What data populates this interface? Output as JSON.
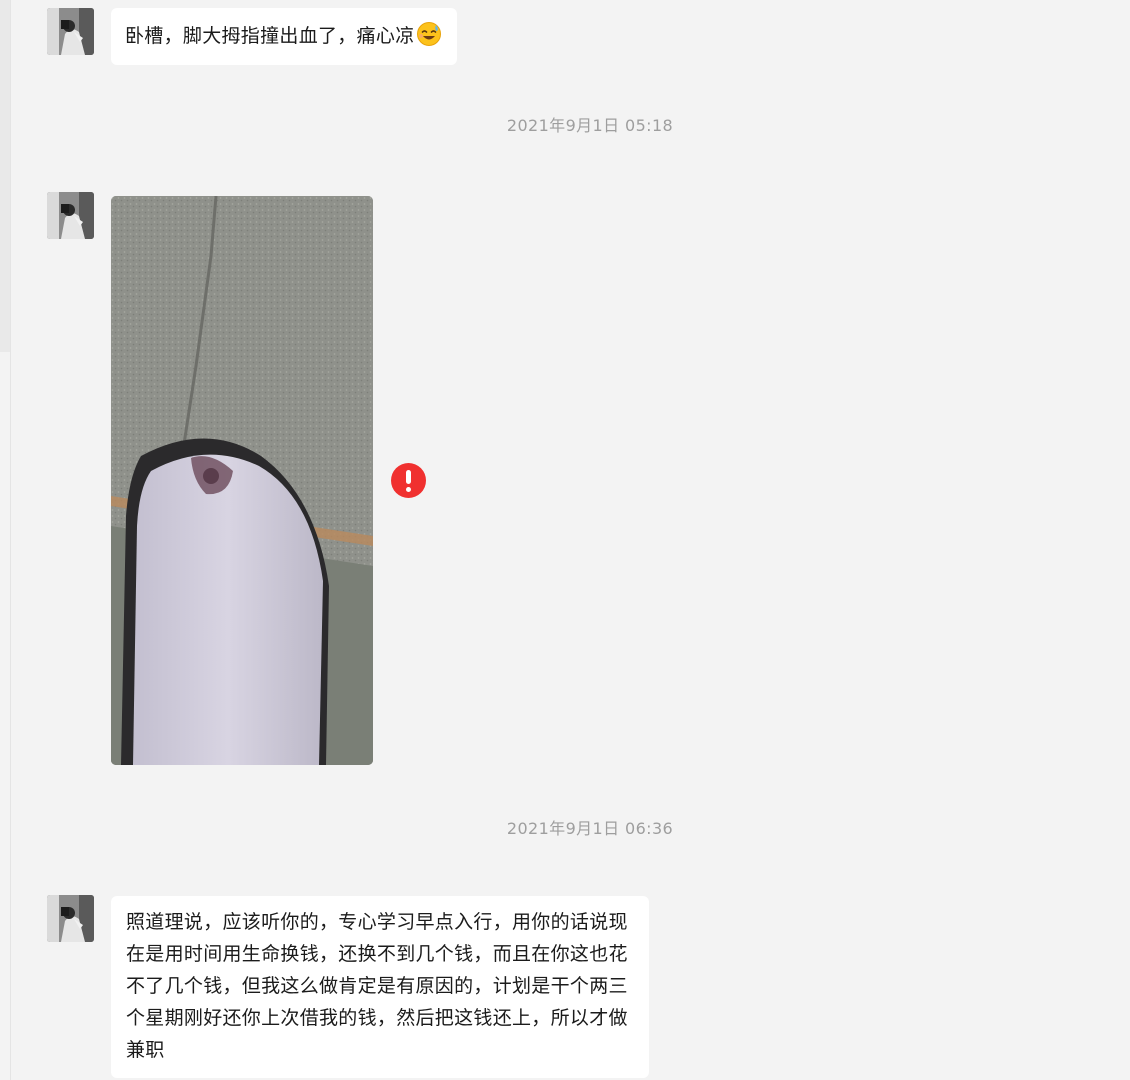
{
  "messages": [
    {
      "type": "text",
      "text": "卧槽，脚大拇指撞出血了，痛心凉",
      "emoji": "sweat-smile-emoji"
    },
    {
      "type": "image",
      "image_subject": "toe-in-sock-photo",
      "status_icon": "error-icon",
      "status_color": "#f0302f"
    },
    {
      "type": "text",
      "text": "照道理说，应该听你的，专心学习早点入行，用你的话说现在是用时间用生命换钱，还换不到几个钱，而且在你这也花不了几个钱，但我这么做肯定是有原因的，计划是干个两三个星期刚好还你上次借我的钱，然后把这钱还上，所以才做兼职"
    }
  ],
  "timestamps": [
    "2021年9月1日 05:18",
    "2021年9月1日 06:36"
  ],
  "colors": {
    "background": "#f3f3f3",
    "bubble": "#ffffff",
    "timestamp": "#9e9e9e",
    "error": "#f0302f"
  }
}
